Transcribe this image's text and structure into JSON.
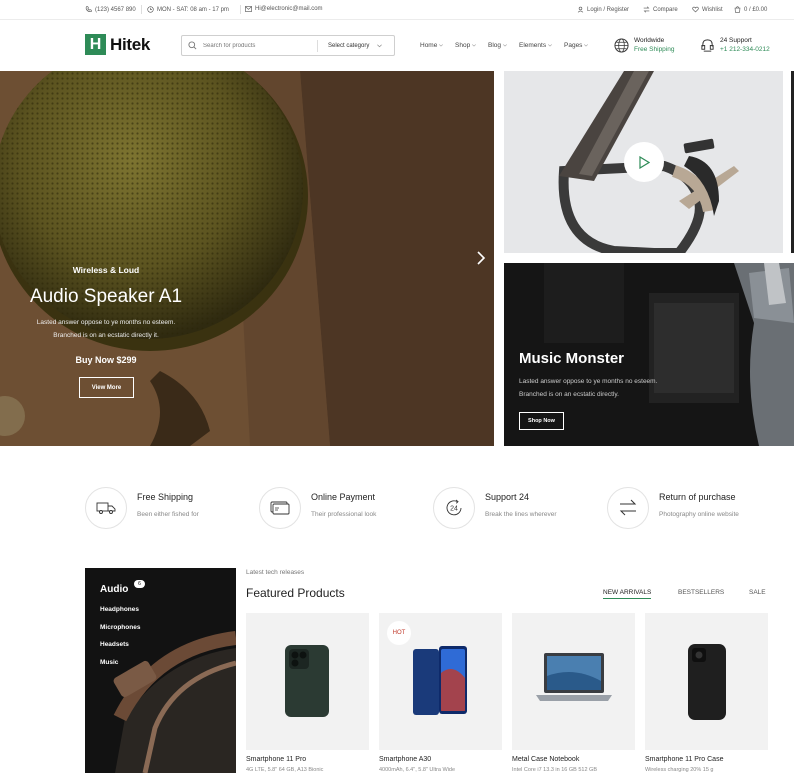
{
  "topbar": {
    "phone": "(123) 4567 890",
    "hours": "MON - SAT: 08 am - 17 pm",
    "email": "Hi@electronic@mail.com",
    "login": "Login / Register",
    "compare": "Compare",
    "wishlist": "Wishlist",
    "cart": "0 / £0.00"
  },
  "header": {
    "logo_letter": "H",
    "logo_text": "Hitek",
    "search_placeholder": "Search for products",
    "search_category": "Select category",
    "nav": [
      "Home",
      "Shop",
      "Blog",
      "Elements",
      "Pages"
    ],
    "shipping_title": "Worldwide",
    "shipping_sub": "Free Shipping",
    "support_title": "24 Support",
    "support_sub": "+1 212-334-0212"
  },
  "hero": {
    "eyebrow": "Wireless & Loud",
    "title": "Audio Speaker A1",
    "desc1": "Lasted answer oppose to ye months no esteem.",
    "desc2": "Branched is on an ecstatic directly it.",
    "price": "Buy Now $299",
    "button": "View More"
  },
  "promo2": {
    "title": "Music Monster",
    "desc1": "Lasted answer oppose to ye months no esteem.",
    "desc2": "Branched is on an ecstatic directly.",
    "button": "Shop Now"
  },
  "features": [
    {
      "title": "Free Shipping",
      "sub": "Been either fished for",
      "icon": "truck-icon"
    },
    {
      "title": "Online Payment",
      "sub": "Their professional look",
      "icon": "card-icon"
    },
    {
      "title": "Support 24",
      "sub": "Break the lines wherever",
      "icon": "support-24-icon"
    },
    {
      "title": "Return of purchase",
      "sub": "Photography online website",
      "icon": "return-arrows-icon"
    }
  ],
  "category": {
    "title": "Audio",
    "badge": "6",
    "items": [
      "Headphones",
      "Microphones",
      "Headsets",
      "Music"
    ]
  },
  "featured": {
    "eyebrow": "Latest tech releases",
    "title": "Featured Products",
    "tabs": [
      "NEW ARRIVALS",
      "BESTSELLERS",
      "SALE"
    ],
    "products": [
      {
        "name": "Smartphone 11 Pro",
        "desc": "4G LTE, 5.8\" 64 GB, A13 Bionic",
        "badge": ""
      },
      {
        "name": "Smartphone A30",
        "desc": "4000mAh, 6.4\", 5.8\" Ultra Wide",
        "badge": "HOT"
      },
      {
        "name": "Metal Case Notebook",
        "desc": "Intel Core i7 13.3 in 16 GB 512 GB",
        "badge": ""
      },
      {
        "name": "Smartphone 11 Pro Case",
        "desc": "Wireless charging 20% 15 g",
        "badge": ""
      }
    ]
  },
  "colors": {
    "accent": "#2e8b57",
    "dark": "#121212"
  }
}
